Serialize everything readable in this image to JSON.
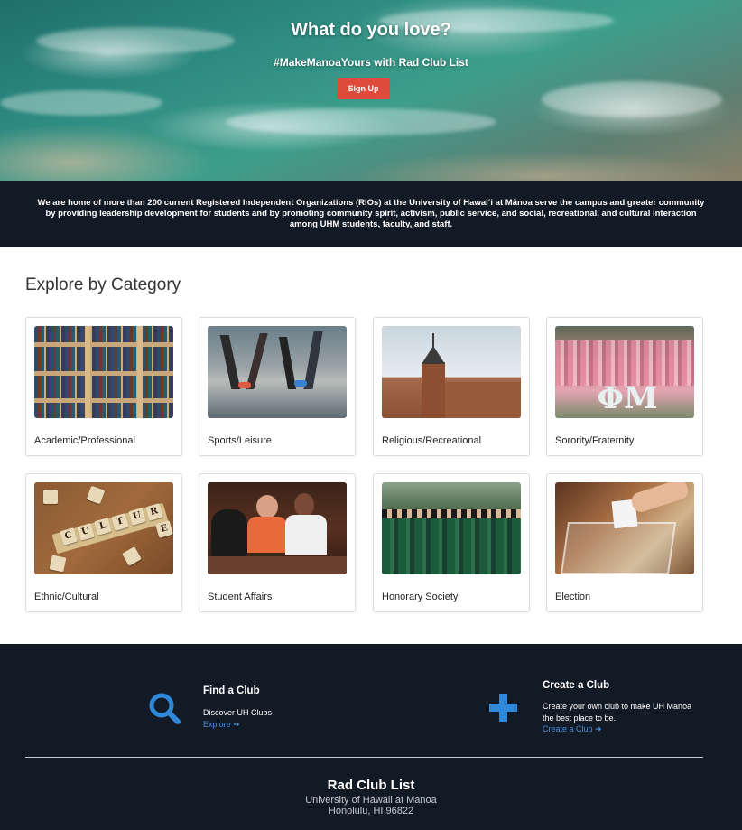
{
  "hero": {
    "title": "What do you love?",
    "subtitle": "#MakeManoaYours with Rad Club List",
    "signup_label": "Sign Up"
  },
  "intro": {
    "text": "We are home of more than 200 current Registered Independent Organizations (RIOs) at the University of Hawaiʻi at Mānoa serve the campus and greater community by providing leadership development for students and by promoting community spirit, activism, public service, and social, recreational, and cultural interaction among UHM students, faculty, and staff."
  },
  "categories": {
    "title": "Explore by Category",
    "items": [
      {
        "label": "Academic/Professional"
      },
      {
        "label": "Sports/Leisure"
      },
      {
        "label": "Religious/Recreational"
      },
      {
        "label": "Sorority/Fraternity"
      },
      {
        "label": "Ethnic/Cultural"
      },
      {
        "label": "Student Affairs"
      },
      {
        "label": "Honorary Society"
      },
      {
        "label": "Election"
      }
    ],
    "culture_tiles": [
      "C",
      "U",
      "L",
      "T",
      "U",
      "R",
      "E"
    ],
    "sorority_letters": "ΦM"
  },
  "footer": {
    "find": {
      "title": "Find a Club",
      "desc": "Discover UH Clubs",
      "link": "Explore"
    },
    "create": {
      "title": "Create a Club",
      "desc": "Create your own club to make UH Manoa the best place to be.",
      "link": "Create a Club"
    },
    "brand": "Rad Club List",
    "address_line1": "University of Hawaii at Manoa",
    "address_line2": "Honolulu, HI 96822",
    "link_color": "#4a90d9"
  }
}
